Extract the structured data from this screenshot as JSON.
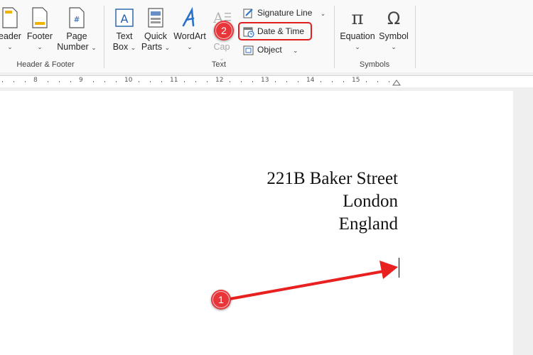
{
  "ribbon": {
    "groups": {
      "header_footer": "Header & Footer",
      "text": "Text",
      "symbols": "Symbols"
    },
    "tools": {
      "header": "eader",
      "footer": "Footer",
      "page_number_1": "Page",
      "page_number_2": "Number",
      "text_box_1": "Text",
      "text_box_2": "Box",
      "quick_parts_1": "Quick",
      "quick_parts_2": "Parts",
      "wordart": "WordArt",
      "drop_cap": "Cap",
      "signature_line": "Signature Line",
      "date_time": "Date & Time",
      "object": "Object",
      "equation": "Equation",
      "symbol": "Symbol"
    }
  },
  "ruler": {
    "numbers": [
      "8",
      "9",
      "10",
      "11",
      "12",
      "13",
      "14",
      "15"
    ]
  },
  "document": {
    "address": [
      "221B Baker Street",
      "London",
      "England"
    ]
  },
  "annotations": {
    "step1": "1",
    "step2": "2",
    "accent": "#e8353a"
  }
}
